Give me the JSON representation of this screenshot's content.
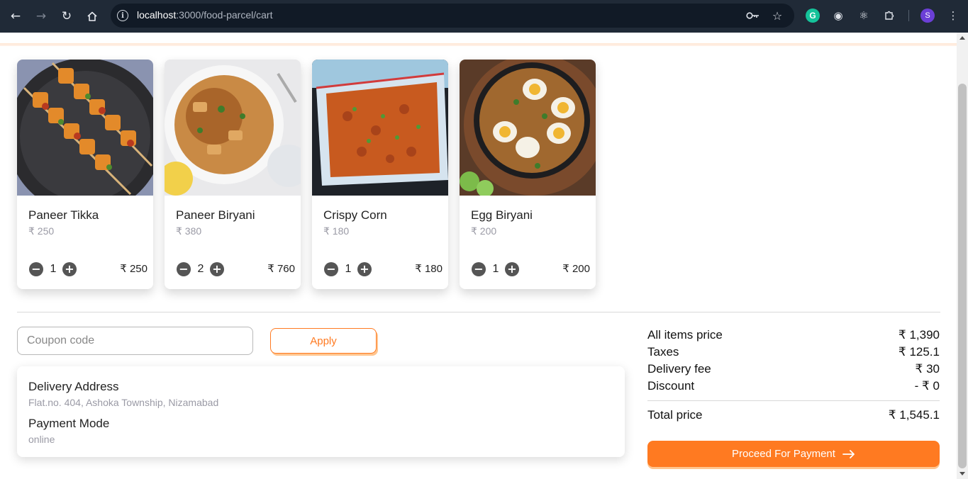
{
  "browser": {
    "url_host": "localhost",
    "url_path": ":3000/food-parcel/cart",
    "profile_initial": "S"
  },
  "cart": {
    "items": [
      {
        "name": "Paneer Tikka",
        "price": "₹ 250",
        "quantity": "1",
        "total": "₹ 250"
      },
      {
        "name": "Paneer Biryani",
        "price": "₹ 380",
        "quantity": "2",
        "total": "₹ 760"
      },
      {
        "name": "Crispy Corn",
        "price": "₹ 180",
        "quantity": "1",
        "total": "₹ 180"
      },
      {
        "name": "Egg Biryani",
        "price": "₹ 200",
        "quantity": "1",
        "total": "₹ 200"
      }
    ]
  },
  "coupon": {
    "placeholder": "Coupon code",
    "value": "",
    "apply_label": "Apply"
  },
  "delivery": {
    "address_label": "Delivery Address",
    "address_value": "Flat.no. 404, Ashoka Township, Nizamabad",
    "payment_label": "Payment Mode",
    "payment_value": "online"
  },
  "summary": {
    "items_price_label": "All items price",
    "items_price_value": "₹ 1,390",
    "taxes_label": "Taxes",
    "taxes_value": "₹ 125.1",
    "delivery_fee_label": "Delivery fee",
    "delivery_fee_value": "₹ 30",
    "discount_label": "Discount",
    "discount_value": "- ₹ 0",
    "total_label": "Total price",
    "total_value": "₹ 1,545.1"
  },
  "actions": {
    "proceed_label": "Proceed For Payment"
  },
  "colors": {
    "accent": "#ff7a21",
    "chrome": "#202a37"
  }
}
